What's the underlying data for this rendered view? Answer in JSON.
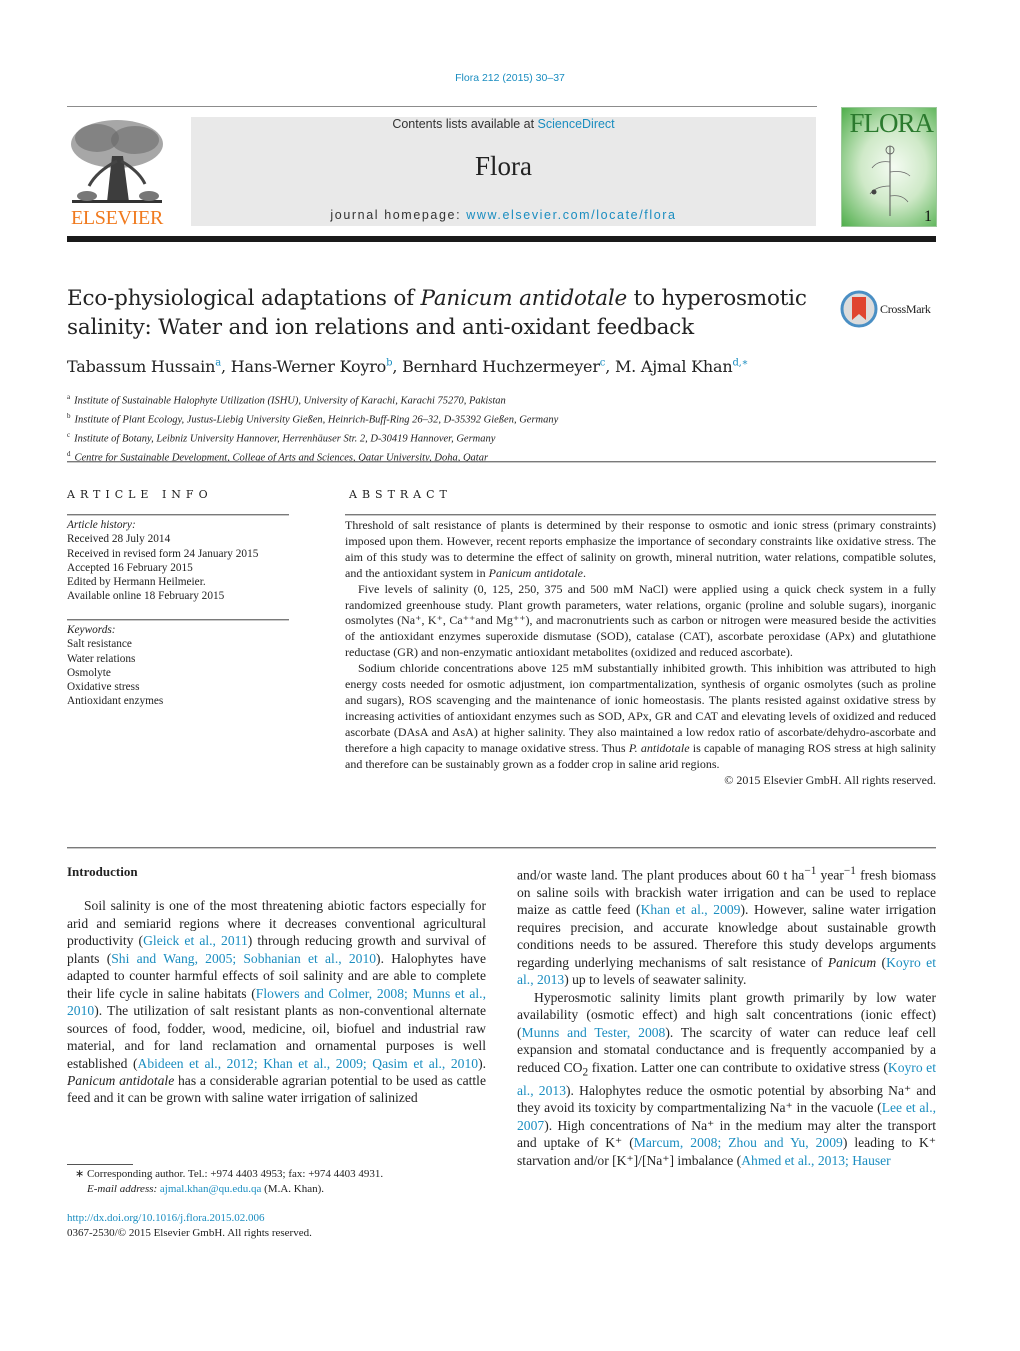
{
  "header": {
    "journal_ref": "Flora 212 (2015) 30–37",
    "contents_prefix": "Contents lists available at ",
    "contents_link": "ScienceDirect",
    "journal_title": "Flora",
    "homepage_prefix": "journal homepage: ",
    "homepage_link": "www.elsevier.com/locate/flora",
    "publisher_logo_text": "ELSEVIER",
    "cover_title": "FLORA",
    "cover_issue": "1",
    "crossmark_label": "CrossMark"
  },
  "article": {
    "title_part1": "Eco-physiological adaptations of ",
    "title_italic": "Panicum antidotale",
    "title_part2": " to hyperosmotic salinity: Water and ion relations and anti-oxidant feedback",
    "authors": [
      {
        "name": "Tabassum Hussain",
        "sup": "a"
      },
      {
        "name": "Hans-Werner Koyro",
        "sup": "b"
      },
      {
        "name": "Bernhard Huchzermeyer",
        "sup": "c"
      },
      {
        "name": "M. Ajmal Khan",
        "sup": "d,∗"
      }
    ],
    "affiliations": [
      {
        "sup": "a",
        "text": "Institute of Sustainable Halophyte Utilization (ISHU), University of Karachi, Karachi 75270, Pakistan"
      },
      {
        "sup": "b",
        "text": "Institute of Plant Ecology, Justus-Liebig University Gießen, Heinrich-Buff-Ring 26–32, D-35392 Gießen, Germany"
      },
      {
        "sup": "c",
        "text": "Institute of Botany, Leibniz University Hannover, Herrenhäuser Str. 2, D-30419 Hannover, Germany"
      },
      {
        "sup": "d",
        "text": "Centre for Sustainable Development, College of Arts and Sciences, Qatar University, Doha, Qatar"
      }
    ]
  },
  "article_info": {
    "heading": "ARTICLE INFO",
    "history_label": "Article history:",
    "history": [
      "Received 28 July 2014",
      "Received in revised form 24 January 2015",
      "Accepted 16 February 2015",
      "Edited by Hermann Heilmeier.",
      "Available online 18 February 2015"
    ],
    "keywords_label": "Keywords:",
    "keywords": [
      "Salt resistance",
      "Water relations",
      "Osmolyte",
      "Oxidative stress",
      "Antioxidant enzymes"
    ]
  },
  "abstract": {
    "heading": "ABSTRACT",
    "p1_a": "Threshold of salt resistance of plants is determined by their response to osmotic and ionic stress (primary constraints) imposed upon them. However, recent reports emphasize the importance of secondary constraints like oxidative stress. The aim of this study was to determine the effect of salinity on growth, mineral nutrition, water relations, compatible solutes, and the antioxidant system in ",
    "p1_italic": "Panicum antidotale",
    "p1_b": ".",
    "p2": "Five levels of salinity (0, 125, 250, 375 and 500 mM NaCl) were applied using a quick check system in a fully randomized greenhouse study. Plant growth parameters, water relations, organic (proline and soluble sugars), inorganic osmolytes (Na⁺, K⁺, Ca⁺⁺and Mg⁺⁺), and macronutrients such as carbon or nitrogen were measured beside the activities of the antioxidant enzymes superoxide dismutase (SOD), catalase (CAT), ascorbate peroxidase (APx) and glutathione reductase (GR) and non-enzymatic antioxidant metabolites (oxidized and reduced ascorbate).",
    "p3_a": "Sodium chloride concentrations above 125 mM substantially inhibited growth. This inhibition was attributed to high energy costs needed for osmotic adjustment, ion compartmentalization, synthesis of organic osmolytes (such as proline and sugars), ROS scavenging and the maintenance of ionic homeostasis. The plants resisted against oxidative stress by increasing activities of antioxidant enzymes such as SOD, APx, GR and CAT and elevating levels of oxidized and reduced ascorbate (DAsA and AsA) at higher salinity. They also maintained a low redox ratio of ascorbate/dehydro-ascorbate and therefore a high capacity to manage oxidative stress. Thus ",
    "p3_italic": "P. antidotale",
    "p3_b": " is capable of managing ROS stress at high salinity and therefore can be sustainably grown as a fodder crop in saline arid regions.",
    "copyright": "© 2015 Elsevier GmbH. All rights reserved."
  },
  "body": {
    "intro_heading": "Introduction",
    "left": {
      "t1": "Soil salinity is one of the most threatening abiotic factors especially for arid and semiarid regions where it decreases conventional agricultural productivity (",
      "c1": "Gleick et al., 2011",
      "t2": ") through reducing growth and survival of plants (",
      "c2": "Shi and Wang, 2005; Sobhanian et al., 2010",
      "t3": "). Halophytes have adapted to counter harmful effects of soil salinity and are able to complete their life cycle in saline habitats (",
      "c3": "Flowers and Colmer, 2008; Munns et al., 2010",
      "t4": "). The utilization of salt resistant plants as non-conventional alternate sources of food, fodder, wood, medicine, oil, biofuel and industrial raw material, and for land reclamation and ornamental purposes is well established (",
      "c4": "Abideen et al., 2012; Khan et al., 2009; Qasim et al., 2010",
      "t5": "). ",
      "i1": "Panicum antidotale",
      "t6": " has a considerable agrarian potential to be used as cattle feed and it can be grown with saline water irrigation of salinized"
    },
    "right1": {
      "t1": "and/or waste land. The plant produces about 60 t ha",
      "sup1": "−1",
      "t2": " year",
      "sup2": "−1",
      "t3": " fresh biomass on saline soils with brackish water irrigation and can be used to replace maize as cattle feed (",
      "c1": "Khan et al., 2009",
      "t4": "). However, saline water irrigation requires precision, and accurate knowledge about sustainable growth conditions needs to be assured. Therefore this study develops arguments regarding underlying mechanisms of salt resistance of ",
      "i1": "Panicum",
      "t5": " (",
      "c2": "Koyro et al., 2013",
      "t6": ") up to levels of seawater salinity."
    },
    "right2": {
      "t1": "Hyperosmotic salinity limits plant growth primarily by low water availability (osmotic effect) and high salt concentrations (ionic effect) (",
      "c1": "Munns and Tester, 2008",
      "t2": "). The scarcity of water can reduce leaf cell expansion and stomatal conductance and is frequently accompanied by a reduced CO",
      "sub1": "2",
      "t3": " fixation. Latter one can contribute to oxidative stress (",
      "c2": "Koyro et al., 2013",
      "t4": "). Halophytes reduce the osmotic potential by absorbing Na⁺ and they avoid its toxicity by compartmentalizing Na⁺ in the vacuole (",
      "c3": "Lee et al., 2007",
      "t5": "). High concentrations of Na⁺ in the medium may alter the transport and uptake of K⁺ (",
      "c4": "Marcum, 2008; Zhou and Yu, 2009",
      "t6": ") leading to K⁺ starvation and/or [K⁺]/[Na⁺] imbalance (",
      "c5": "Ahmed et al., 2013; Hauser"
    }
  },
  "footnote": {
    "corresponding": "∗  Corresponding author. Tel.: +974 4403 4953; fax: +974 4403 4931.",
    "email_label": "E-mail address: ",
    "email": "ajmal.khan@qu.edu.qa",
    "email_suffix": " (M.A. Khan).",
    "doi": "http://dx.doi.org/10.1016/j.flora.2015.02.006",
    "issn": "0367-2530/© 2015 Elsevier GmbH. All rights reserved."
  }
}
